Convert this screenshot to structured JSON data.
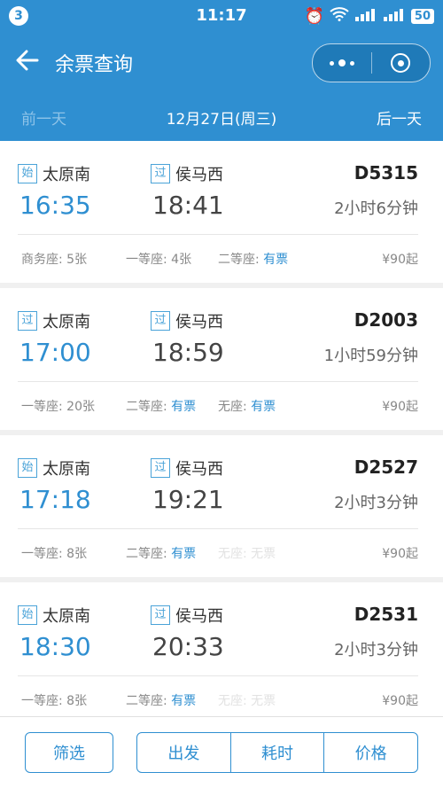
{
  "status": {
    "badge": "3",
    "time": "11:17",
    "battery": "50"
  },
  "header": {
    "title": "余票查询"
  },
  "datebar": {
    "prev": "前一天",
    "date": "12月27日(周三)",
    "next": "后一天"
  },
  "trains": [
    {
      "dep_tag": "始",
      "dep_station": "太原南",
      "arr_tag": "过",
      "arr_station": "侯马西",
      "dep_time": "16:35",
      "arr_time": "18:41",
      "train_no": "D5315",
      "duration": "2小时6分钟",
      "seats": [
        {
          "name": "商务座:",
          "value": "5张",
          "available": false,
          "dim": false
        },
        {
          "name": "一等座:",
          "value": "4张",
          "available": false,
          "dim": false
        },
        {
          "name": "二等座:",
          "value": "有票",
          "available": true,
          "dim": false
        }
      ],
      "price": "¥90起"
    },
    {
      "dep_tag": "过",
      "dep_station": "太原南",
      "arr_tag": "过",
      "arr_station": "侯马西",
      "dep_time": "17:00",
      "arr_time": "18:59",
      "train_no": "D2003",
      "duration": "1小时59分钟",
      "seats": [
        {
          "name": "一等座:",
          "value": "20张",
          "available": false,
          "dim": false
        },
        {
          "name": "二等座:",
          "value": "有票",
          "available": true,
          "dim": false
        },
        {
          "name": "无座:",
          "value": "有票",
          "available": true,
          "dim": false
        }
      ],
      "price": "¥90起"
    },
    {
      "dep_tag": "始",
      "dep_station": "太原南",
      "arr_tag": "过",
      "arr_station": "侯马西",
      "dep_time": "17:18",
      "arr_time": "19:21",
      "train_no": "D2527",
      "duration": "2小时3分钟",
      "seats": [
        {
          "name": "一等座:",
          "value": "8张",
          "available": false,
          "dim": false
        },
        {
          "name": "二等座:",
          "value": "有票",
          "available": true,
          "dim": false
        },
        {
          "name": "无座:",
          "value": "无票",
          "available": false,
          "dim": true
        }
      ],
      "price": "¥90起"
    },
    {
      "dep_tag": "始",
      "dep_station": "太原南",
      "arr_tag": "过",
      "arr_station": "侯马西",
      "dep_time": "18:30",
      "arr_time": "20:33",
      "train_no": "D2531",
      "duration": "2小时3分钟",
      "seats": [
        {
          "name": "一等座:",
          "value": "8张",
          "available": false,
          "dim": false
        },
        {
          "name": "二等座:",
          "value": "有票",
          "available": true,
          "dim": false
        },
        {
          "name": "无座:",
          "value": "无票",
          "available": false,
          "dim": true
        }
      ],
      "price": "¥90起"
    }
  ],
  "bottom": {
    "filter": "筛选",
    "sort_depart": "出发",
    "sort_duration": "耗时",
    "sort_price": "价格"
  },
  "colors": {
    "accent": "#2f8fd1"
  },
  "icons": {
    "back": "arrow-left-icon",
    "menu": "more-dots-icon",
    "close": "target-circle-icon"
  }
}
